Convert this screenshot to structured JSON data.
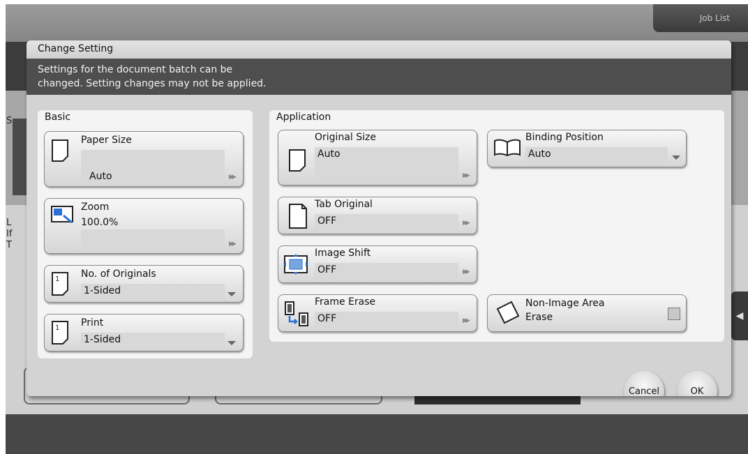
{
  "header": {
    "job_list": "Job List"
  },
  "background": {
    "letter1": "S",
    "letter2": "L",
    "letter3": "If",
    "letter4": "T"
  },
  "dialog": {
    "title": "Change Setting",
    "message_line1": "Settings for the document batch can be",
    "message_line2": "changed. Setting changes may not be applied."
  },
  "basic": {
    "title": "Basic",
    "paper_size": {
      "label": "Paper Size",
      "value": "Auto"
    },
    "zoom": {
      "label": "Zoom",
      "value": "100.0%"
    },
    "no_of_originals": {
      "label": "No. of Originals",
      "value": "1-Sided"
    },
    "print": {
      "label": "Print",
      "value": "1-Sided"
    }
  },
  "application": {
    "title": "Application",
    "original_size": {
      "label": "Original Size",
      "value": "Auto"
    },
    "binding_position": {
      "label": "Binding Position",
      "value": "Auto"
    },
    "tab_original": {
      "label": "Tab Original",
      "value": "OFF"
    },
    "image_shift": {
      "label": "Image Shift",
      "value": "OFF"
    },
    "frame_erase": {
      "label": "Frame Erase",
      "value": "OFF"
    },
    "non_image_area_erase": {
      "label_line1": "Non-Image Area",
      "label_line2": "Erase"
    }
  },
  "footer": {
    "cancel": "Cancel",
    "ok": "OK"
  }
}
